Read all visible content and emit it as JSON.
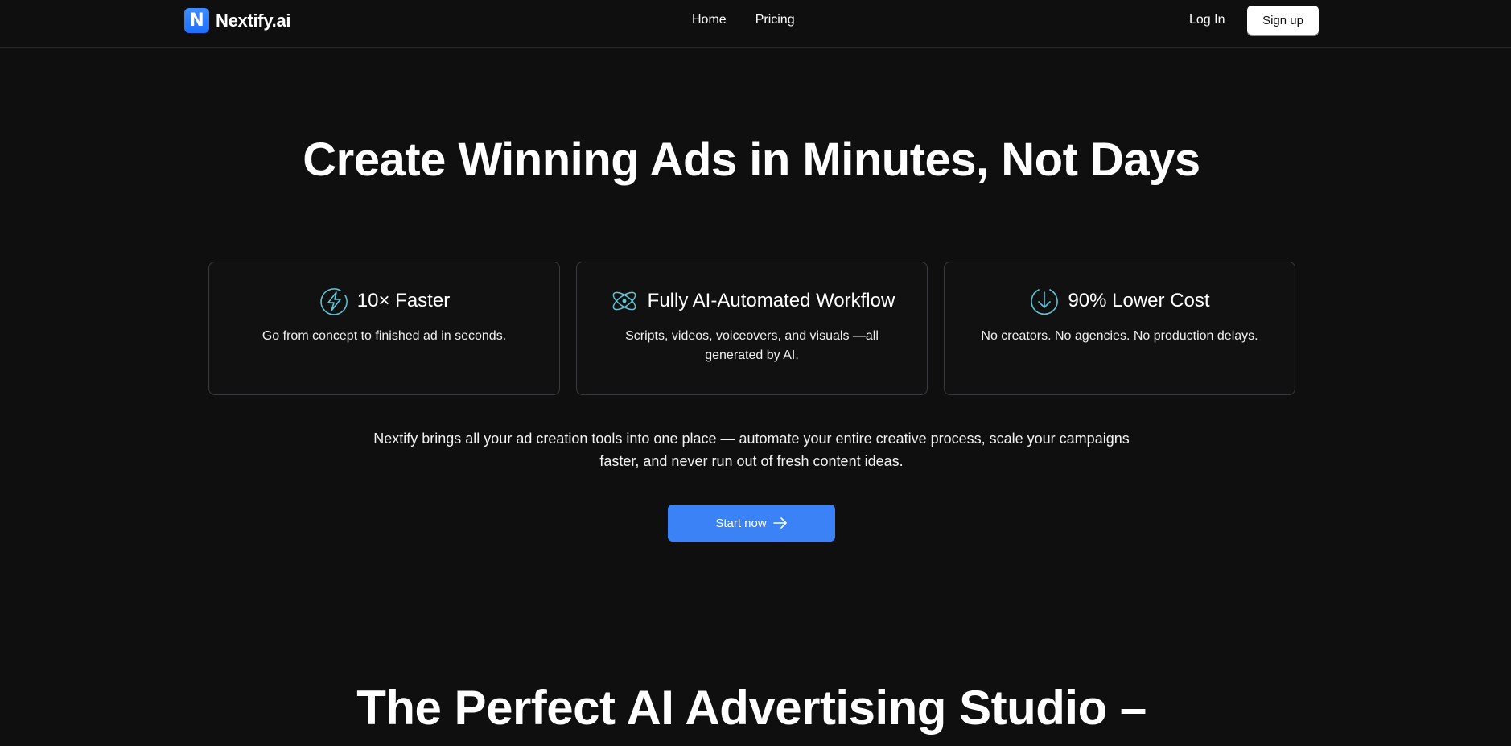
{
  "nav": {
    "brand_mark": "N",
    "brand_name": "Nextify.ai",
    "links": [
      "Home",
      "Pricing"
    ],
    "login_label": "Log In",
    "signup_label": "Sign up"
  },
  "hero": {
    "title": "Create Winning Ads in Minutes, Not Days",
    "cards": [
      {
        "icon": "lightning-icon",
        "title": "10× Faster",
        "description": "Go from concept to finished ad in seconds."
      },
      {
        "icon": "atom-icon",
        "title": "Fully AI-Automated Workflow",
        "description": "Scripts, videos, voiceovers, and visuals —all generated by AI."
      },
      {
        "icon": "arrow-down-circle-icon",
        "title": "90% Lower Cost",
        "description": "No creators. No agencies. No production delays."
      }
    ],
    "lede": "Nextify brings all your ad creation tools into one place — automate your entire creative process, scale your campaigns faster, and never run out of fresh content ideas.",
    "cta_label": "Start now"
  },
  "section": {
    "title": "The Perfect AI Advertising Studio –"
  },
  "colors": {
    "background": "#0f0f10",
    "accent": "#3b82f6",
    "icon_stroke": "#5ec4d6"
  }
}
